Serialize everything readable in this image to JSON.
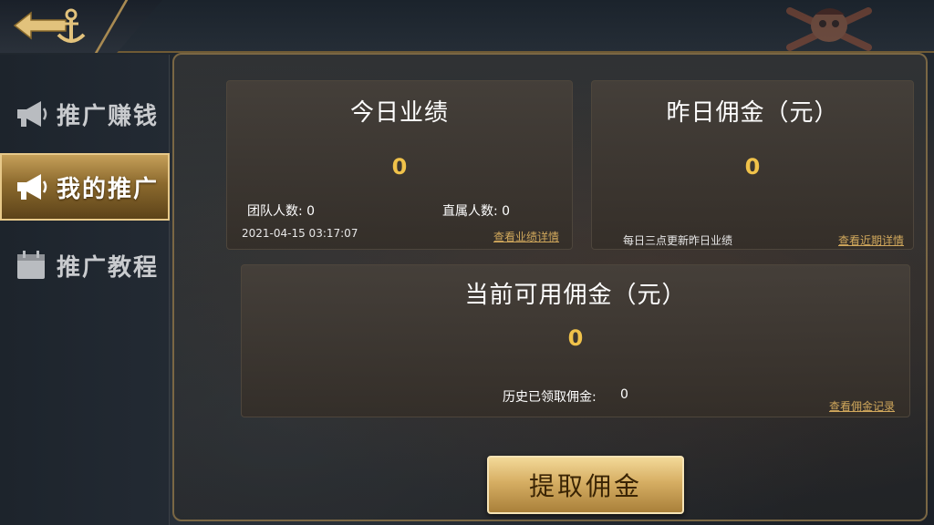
{
  "nav": {
    "back_icon": "anchor-back-icon",
    "decor_icon": "skull-crossbones-icon"
  },
  "sidebar": {
    "items": [
      {
        "label": "推广赚钱",
        "icon": "megaphone-icon",
        "active": false
      },
      {
        "label": "我的推广",
        "icon": "megaphone-icon",
        "active": true
      },
      {
        "label": "推广教程",
        "icon": "calendar-icon",
        "active": false
      }
    ]
  },
  "today": {
    "title": "今日业绩",
    "value": "0",
    "team_label": "团队人数: 0",
    "direct_label": "直属人数: 0",
    "timestamp": "2021-04-15 03:17:07",
    "detail_link": "查看业绩详情"
  },
  "yesterday": {
    "title": "昨日佣金（元）",
    "value": "0",
    "note": "每日三点更新昨日业绩",
    "detail_link": "查看近期详情"
  },
  "available": {
    "title": "当前可用佣金（元）",
    "value": "0",
    "history_label": "历史已领取佣金:",
    "history_value": "0",
    "record_link": "查看佣金记录"
  },
  "actions": {
    "withdraw_label": "提取佣金"
  },
  "colors": {
    "accent_gold": "#f0c24a",
    "link_gold": "#d1a85c",
    "frame_border": "#7a6744"
  }
}
